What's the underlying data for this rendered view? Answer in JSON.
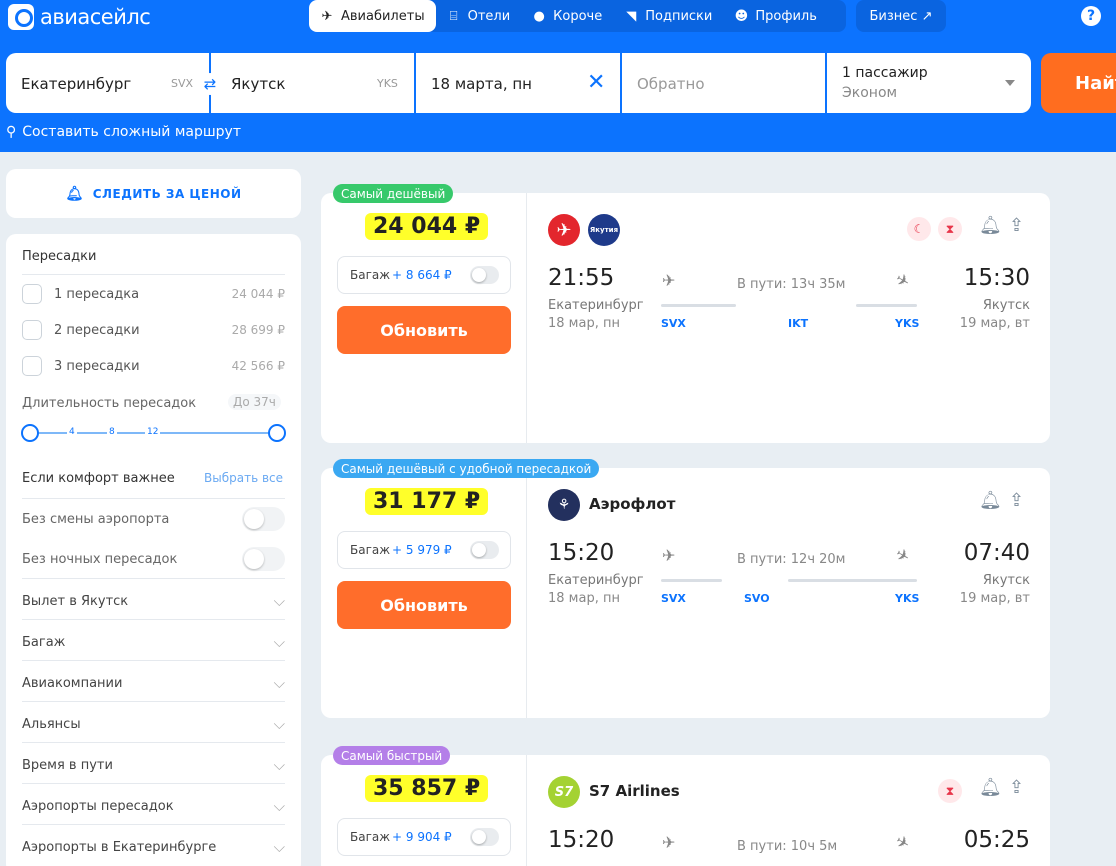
{
  "brand": {
    "name": "авиасейлс"
  },
  "nav": {
    "tickets": "Авиабилеты",
    "hotels": "Отели",
    "short": "Короче",
    "subscriptions": "Подписки",
    "profile": "Профиль",
    "business": "Бизнес ↗",
    "help": "?"
  },
  "search": {
    "origin": "Екатеринбург",
    "origin_code": "SVX",
    "destination": "Якутск",
    "destination_code": "YKS",
    "depart": "18 марта, пн",
    "return_placeholder": "Обратно",
    "passengers": "1 пассажир",
    "cabin": "Эконом",
    "find": "Найти",
    "complex_route": "Составить сложный маршрут"
  },
  "watch": {
    "label": "СЛЕДИТЬ ЗА ЦЕНОЙ"
  },
  "filters": {
    "transfers_title": "Пересадки",
    "transfers": [
      {
        "label": "1 пересадка",
        "price": "24 044 ₽"
      },
      {
        "label": "2 пересадки",
        "price": "28 699 ₽"
      },
      {
        "label": "3 пересадки",
        "price": "42 566 ₽"
      }
    ],
    "duration_label": "Длительность пересадок",
    "duration_value": "До 37ч",
    "slider_ticks": [
      "4",
      "8",
      "12"
    ],
    "comfort_title": "Если комфорт важнее",
    "select_all": "Выбрать все",
    "no_airport_change": "Без смены аэропорта",
    "no_night": "Без ночных пересадок",
    "sections": [
      "Вылет в Якутск",
      "Багаж",
      "Авиакомпании",
      "Альянсы",
      "Время в пути",
      "Аэропорты пересадок",
      "Аэропорты в Екатеринбурге"
    ]
  },
  "results": [
    {
      "badge": "Самый дешёвый",
      "badge_color": "#37c96b",
      "price": "24 044 ₽",
      "baggage_label": "Багаж",
      "baggage_price": "+ 8 664 ₽",
      "update": "Обновить",
      "airline_name": "",
      "depart_time": "21:55",
      "depart_city": "Екатеринбург",
      "depart_date": "18 мар, пн",
      "duration": "В пути: 13ч 35м",
      "arrive_time": "15:30",
      "arrive_city": "Якутск",
      "arrive_date": "19 мар, вт",
      "route": [
        "SVX",
        "IKT",
        "YKS"
      ]
    },
    {
      "badge": "Самый дешёвый с удобной пересадкой",
      "badge_color": "#3aa8f2",
      "price": "31 177 ₽",
      "baggage_label": "Багаж",
      "baggage_price": "+ 5 979 ₽",
      "update": "Обновить",
      "airline_name": "Аэрофлот",
      "depart_time": "15:20",
      "depart_city": "Екатеринбург",
      "depart_date": "18 мар, пн",
      "duration": "В пути: 12ч 20м",
      "arrive_time": "07:40",
      "arrive_city": "Якутск",
      "arrive_date": "19 мар, вт",
      "route": [
        "SVX",
        "SVO",
        "YKS"
      ]
    },
    {
      "badge": "Самый быстрый",
      "badge_color": "#b47fe8",
      "price": "35 857 ₽",
      "baggage_label": "Багаж",
      "baggage_price": "+ 9 904 ₽",
      "airline_name": "S7 Airlines",
      "airline_logo": "S7",
      "depart_time": "15:20",
      "duration": "В пути: 10ч 5м",
      "arrive_time": "05:25"
    }
  ],
  "colors": {
    "brand_blue": "#0c73fe",
    "orange": "#ff6d1f",
    "highlight": "#ffff2a"
  }
}
